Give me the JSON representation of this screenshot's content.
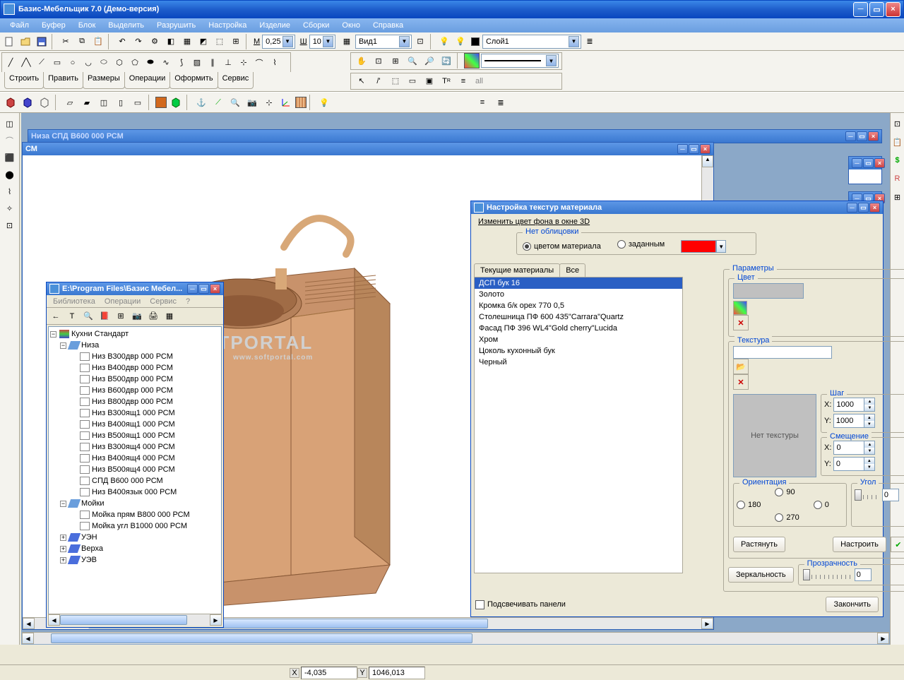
{
  "window": {
    "title": "Базис-Мебельщик 7.0 (Демо-версия)"
  },
  "menu": [
    "Файл",
    "Буфер",
    "Блок",
    "Выделить",
    "Разрушить",
    "Настройка",
    "Изделие",
    "Сборки",
    "Окно",
    "Справка"
  ],
  "toolbar1": {
    "m_label": "М",
    "m_value": "0,25",
    "sh_label": "Ш",
    "sh_value": "10",
    "view_value": "Вид1",
    "layer_value": "Слой1"
  },
  "ribbon_tabs": [
    "Строить",
    "Править",
    "Размеры",
    "Операции",
    "Оформить",
    "Сервис"
  ],
  "inner_windows": {
    "back_title": "Низа СПД В600 000 РСМ",
    "front_title": "СМ"
  },
  "watermark": {
    "main": "S  FTPORTAL",
    "sub": "www.softportal.com"
  },
  "library": {
    "title": "E:\\Program Files\\Базис Мебел...",
    "menu": [
      "Библиотека",
      "Операции",
      "Сервис",
      "?"
    ],
    "root": "Кухни Стандарт",
    "niza": "Низа",
    "niza_items": [
      "Низ В300двр 000 РСМ",
      "Низ В400двр 000 РСМ",
      "Низ В500двр 000 РСМ",
      "Низ В600двр 000 РСМ",
      "Низ В800двр 000 РСМ",
      "Низ В300ящ1 000 РСМ",
      "Низ В400ящ1 000 РСМ",
      "Низ В500ящ1 000 РСМ",
      "Низ В300ящ4 000 РСМ",
      "Низ В400ящ4 000 РСМ",
      "Низ В500ящ4 000 РСМ",
      "СПД В600 000 РСМ",
      "Низ В400язык 000 РСМ"
    ],
    "moyki": "Мойки",
    "moyki_items": [
      "Мойка прям В800 000 РСМ",
      "Мойка угл В1000 000 РСМ"
    ],
    "tail": [
      "УЭН",
      "Верха",
      "УЭВ"
    ]
  },
  "texdialog": {
    "title": "Настройка текстур материала",
    "linklabel": "Изменить цвет фона в окне 3D",
    "no_facing": "Нет облицовки",
    "by_material": "цветом материала",
    "given": "заданным",
    "swatch_color": "#ff0000",
    "tabs": [
      "Текущие материалы",
      "Все"
    ],
    "materials": [
      "ДСП бук 16",
      "Золото",
      "Кромка б/к орех 770 0,5",
      "Столешница ПФ 600 435\"Carrara\"Quartz",
      "Фасад ПФ 396 WL4\"Gold cherry\"Lucida",
      "Хром",
      "Цоколь кухонный бук",
      "Черный"
    ],
    "params_title": "Параметры",
    "color_title": "Цвет",
    "texture_title": "Текстура",
    "no_texture": "Нет текстуры",
    "step_title": "Шаг",
    "offset_title": "Смещение",
    "angle_title": "Угол",
    "x_label": "X:",
    "y_label": "Y:",
    "step_x": "1000",
    "step_y": "1000",
    "off_x": "0",
    "off_y": "0",
    "angle": "0",
    "orientation": "Ориентация",
    "orient_opts": [
      "180",
      "90",
      "270",
      "0"
    ],
    "stretch": "Растянуть",
    "configure": "Настроить",
    "mirror": "Зеркальность",
    "transparency": "Прозрачность",
    "transparency_val": "0",
    "highlight": "Подсвечивать панели",
    "finish": "Закончить"
  },
  "status": {
    "x": "-4,035",
    "y": "1046,013"
  }
}
